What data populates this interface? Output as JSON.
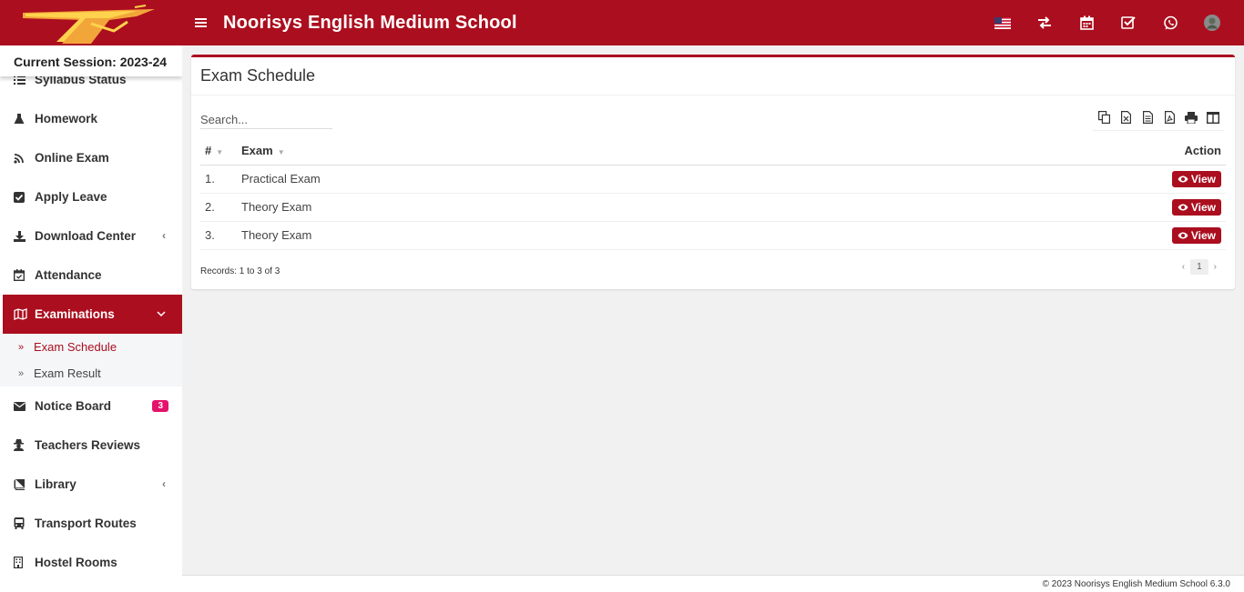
{
  "header": {
    "title": "Noorisys English Medium School",
    "colors": {
      "brand": "#ab0e1e",
      "badge": "#e4146a"
    },
    "icons": [
      "us-flag-icon",
      "switch-icon",
      "calendar-icon",
      "check-square-icon",
      "whatsapp-icon",
      "user-avatar-icon"
    ]
  },
  "sidebar": {
    "session": "Current Session: 2023-24",
    "items": [
      {
        "label": "Syllabus Status",
        "icon": "list-icon"
      },
      {
        "label": "Homework",
        "icon": "flask-icon"
      },
      {
        "label": "Online Exam",
        "icon": "rss-icon"
      },
      {
        "label": "Apply Leave",
        "icon": "check-square-icon"
      },
      {
        "label": "Download Center",
        "icon": "download-icon"
      },
      {
        "label": "Attendance",
        "icon": "calendar-check-icon"
      },
      {
        "label": "Examinations",
        "icon": "map-icon"
      },
      {
        "label": "Notice Board",
        "icon": "envelope-icon",
        "badge": "3"
      },
      {
        "label": "Teachers Reviews",
        "icon": "user-secret-icon"
      },
      {
        "label": "Library",
        "icon": "book-icon"
      },
      {
        "label": "Transport Routes",
        "icon": "bus-icon"
      },
      {
        "label": "Hostel Rooms",
        "icon": "building-icon"
      }
    ],
    "submenu": [
      "Exam Schedule",
      "Exam Result"
    ]
  },
  "main": {
    "title": "Exam Schedule",
    "search_placeholder": "Search...",
    "columns": [
      "#",
      "Exam",
      "Action"
    ],
    "rows": [
      {
        "num": "1.",
        "exam": "Practical Exam",
        "action": "View"
      },
      {
        "num": "2.",
        "exam": "Theory Exam",
        "action": "View"
      },
      {
        "num": "3.",
        "exam": "Theory Exam",
        "action": "View"
      }
    ],
    "records": "Records: 1 to 3 of 3",
    "pager": {
      "prev": "‹",
      "page": "1",
      "next": "›"
    }
  },
  "footer": "© 2023 Noorisys English Medium School 6.3.0"
}
